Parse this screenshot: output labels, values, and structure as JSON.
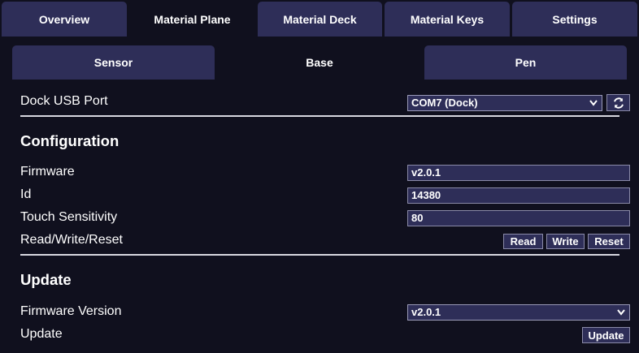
{
  "main_tabs": [
    {
      "label": "Overview"
    },
    {
      "label": "Material Plane"
    },
    {
      "label": "Material Deck"
    },
    {
      "label": "Material Keys"
    },
    {
      "label": "Settings"
    }
  ],
  "sub_tabs": [
    {
      "label": "Sensor"
    },
    {
      "label": "Base"
    },
    {
      "label": "Pen"
    }
  ],
  "dock": {
    "label": "Dock USB Port",
    "selected": "COM7 (Dock)",
    "refresh_icon": "refresh-icon"
  },
  "configuration": {
    "heading": "Configuration",
    "firmware_label": "Firmware",
    "firmware_value": "v2.0.1",
    "id_label": "Id",
    "id_value": "14380",
    "sensitivity_label": "Touch Sensitivity",
    "sensitivity_value": "80",
    "rwr_label": "Read/Write/Reset",
    "read_button": "Read",
    "write_button": "Write",
    "reset_button": "Reset"
  },
  "update": {
    "heading": "Update",
    "version_label": "Firmware Version",
    "version_selected": "v2.0.1",
    "update_label": "Update",
    "update_button": "Update"
  },
  "colors": {
    "background": "#10101e",
    "tab_inactive": "#2e2e58",
    "text": "#ffffff"
  }
}
